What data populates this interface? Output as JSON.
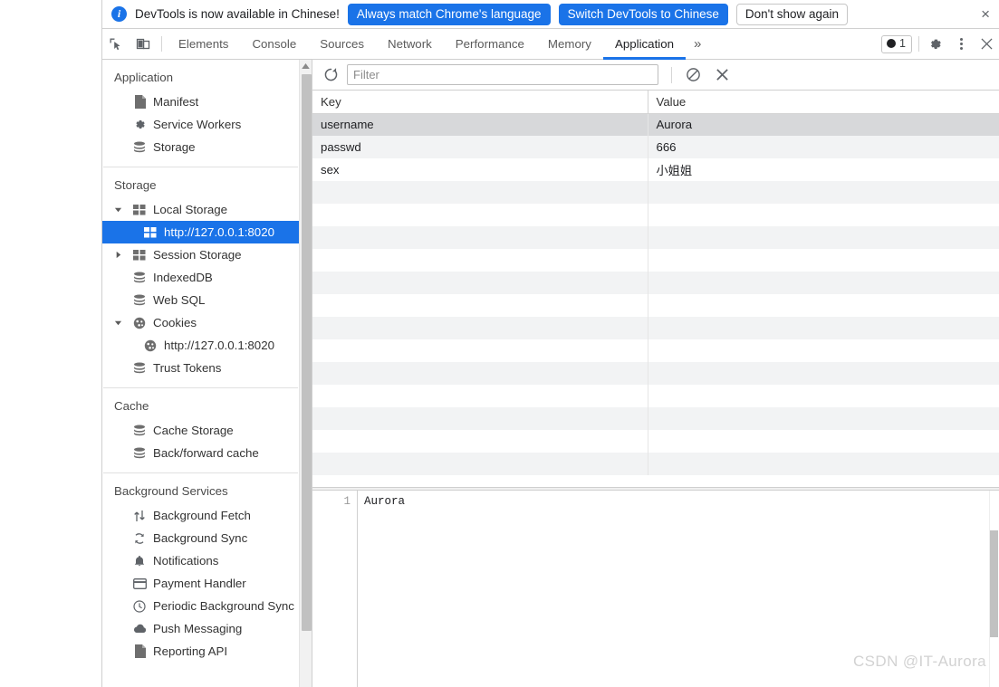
{
  "infobar": {
    "icon": "info-icon",
    "message": "DevTools is now available in Chinese!",
    "primary_button_1": "Always match Chrome's language",
    "primary_button_2": "Switch DevTools to Chinese",
    "secondary_button": "Don't show again",
    "close": "×",
    "accent_color": "#1a73e8"
  },
  "toolbar": {
    "inspect_icon": "inspect-element-icon",
    "device_icon": "device-toolbar-icon",
    "tabs": [
      {
        "label": "Elements",
        "active": false
      },
      {
        "label": "Console",
        "active": false
      },
      {
        "label": "Sources",
        "active": false
      },
      {
        "label": "Network",
        "active": false
      },
      {
        "label": "Performance",
        "active": false
      },
      {
        "label": "Memory",
        "active": false
      },
      {
        "label": "Application",
        "active": true
      }
    ],
    "more_tabs": "»",
    "issues_count": "1",
    "settings_icon": "gear-icon",
    "more_icon": "kebab-menu-icon",
    "close_icon": "close-icon",
    "active_tab_underline_color": "#1a73e8"
  },
  "sidebar": {
    "sections": [
      {
        "title": "Application",
        "items": [
          {
            "label": "Manifest",
            "icon": "manifest-document-icon",
            "level": 2,
            "twisty": "none",
            "selected": false
          },
          {
            "label": "Service Workers",
            "icon": "gear-icon",
            "level": 2,
            "twisty": "none",
            "selected": false
          },
          {
            "label": "Storage",
            "icon": "database-icon",
            "level": 2,
            "twisty": "none",
            "selected": false
          }
        ]
      },
      {
        "title": "Storage",
        "items": [
          {
            "label": "Local Storage",
            "icon": "table-grid-icon",
            "level": 2,
            "twisty": "expanded",
            "selected": false
          },
          {
            "label": "http://127.0.0.1:8020",
            "icon": "table-grid-icon",
            "level": 3,
            "twisty": "none",
            "selected": true
          },
          {
            "label": "Session Storage",
            "icon": "table-grid-icon",
            "level": 2,
            "twisty": "collapsed",
            "selected": false
          },
          {
            "label": "IndexedDB",
            "icon": "database-icon",
            "level": 2,
            "twisty": "none",
            "selected": false
          },
          {
            "label": "Web SQL",
            "icon": "database-icon",
            "level": 2,
            "twisty": "none",
            "selected": false
          },
          {
            "label": "Cookies",
            "icon": "cookie-icon",
            "level": 2,
            "twisty": "expanded",
            "selected": false
          },
          {
            "label": "http://127.0.0.1:8020",
            "icon": "cookie-icon",
            "level": 3,
            "twisty": "none",
            "selected": false
          },
          {
            "label": "Trust Tokens",
            "icon": "database-icon",
            "level": 2,
            "twisty": "none",
            "selected": false
          }
        ]
      },
      {
        "title": "Cache",
        "items": [
          {
            "label": "Cache Storage",
            "icon": "database-icon",
            "level": 2,
            "twisty": "none",
            "selected": false
          },
          {
            "label": "Back/forward cache",
            "icon": "database-icon",
            "level": 2,
            "twisty": "none",
            "selected": false
          }
        ]
      },
      {
        "title": "Background Services",
        "items": [
          {
            "label": "Background Fetch",
            "icon": "up-down-arrows-icon",
            "level": 2,
            "twisty": "none",
            "selected": false
          },
          {
            "label": "Background Sync",
            "icon": "sync-refresh-icon",
            "level": 2,
            "twisty": "none",
            "selected": false
          },
          {
            "label": "Notifications",
            "icon": "bell-icon",
            "level": 2,
            "twisty": "none",
            "selected": false
          },
          {
            "label": "Payment Handler",
            "icon": "credit-card-icon",
            "level": 2,
            "twisty": "none",
            "selected": false
          },
          {
            "label": "Periodic Background Sync",
            "icon": "clock-icon",
            "level": 2,
            "twisty": "none",
            "selected": false
          },
          {
            "label": "Push Messaging",
            "icon": "cloud-icon",
            "level": 2,
            "twisty": "none",
            "selected": false
          },
          {
            "label": "Reporting API",
            "icon": "document-icon",
            "level": 2,
            "twisty": "none",
            "selected": false
          }
        ]
      }
    ],
    "selected_highlight_color": "#1a73e8"
  },
  "filter_bar": {
    "refresh_icon": "refresh-icon",
    "filter_placeholder": "Filter",
    "filter_value": "",
    "clear_all_icon": "clear-all-no-entry-icon",
    "delete_selected_icon": "delete-selected-x-icon"
  },
  "storage_table": {
    "columns": [
      "Key",
      "Value"
    ],
    "rows": [
      {
        "key": "username",
        "value": "Aurora",
        "selected": true
      },
      {
        "key": "passwd",
        "value": "666",
        "selected": false
      },
      {
        "key": "sex",
        "value": "小姐姐",
        "selected": false
      }
    ],
    "empty_row_count": 13
  },
  "preview": {
    "line_number": "1",
    "content": "Aurora"
  },
  "watermark": "CSDN @IT-Aurora"
}
